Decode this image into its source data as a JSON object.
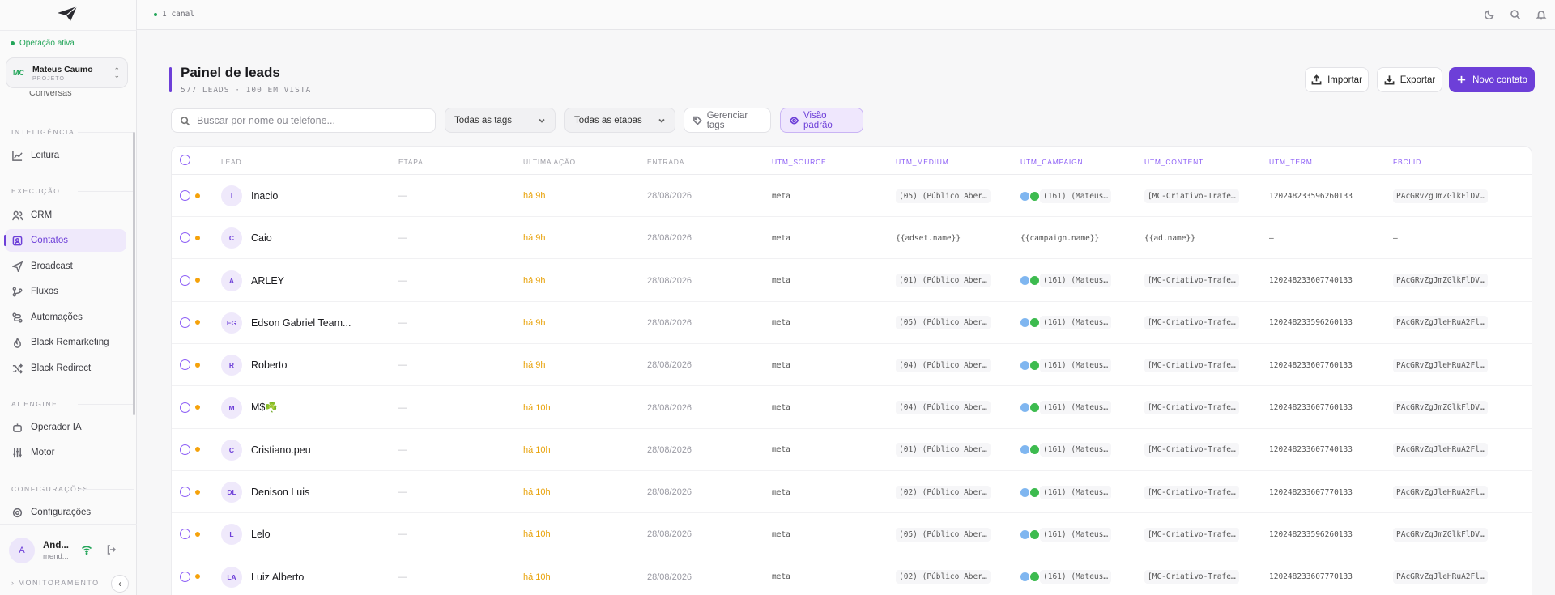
{
  "sidebar": {
    "status": "Operação ativa",
    "project": {
      "initials": "MC",
      "name": "Mateus Caumo",
      "sub": "PROJETO"
    },
    "cut_item": "Conversas",
    "sections": {
      "inteligencia": "INTELIGÊNCIA",
      "execucao": "EXECUÇÃO",
      "ai_engine": "AI ENGINE",
      "config": "CONFIGURAÇÕES"
    },
    "items": {
      "leitura": "Leitura",
      "crm": "CRM",
      "contatos": "Contatos",
      "broadcast": "Broadcast",
      "fluxos": "Fluxos",
      "automacoes": "Automações",
      "black_remarketing": "Black Remarketing",
      "black_redirect": "Black Redirect",
      "operador_ia": "Operador IA",
      "motor": "Motor",
      "configuracoes": "Configurações"
    },
    "user": {
      "initial": "A",
      "name": "And...",
      "email": "mend..."
    },
    "monitor": "MONITORAMENTO"
  },
  "topbar": {
    "channel": "1 canal"
  },
  "page": {
    "title": "Painel de leads",
    "subtitle": "577 LEADS · 100 EM VISTA",
    "import": "Importar",
    "export": "Exportar",
    "new_contact": "Novo contato"
  },
  "filters": {
    "search_placeholder": "Buscar por nome ou telefone...",
    "tags": "Todas as tags",
    "stages": "Todas as etapas",
    "manage_tags": "Gerenciar tags",
    "view": "Visão padrão"
  },
  "table": {
    "headers": {
      "lead": "LEAD",
      "etapa": "ETAPA",
      "ultima": "ÚLTIMA AÇÃO",
      "entrada": "ENTRADA",
      "utm_source": "UTM_SOURCE",
      "utm_medium": "UTM_MEDIUM",
      "utm_campaign": "UTM_CAMPAIGN",
      "utm_content": "UTM_CONTENT",
      "utm_term": "UTM_TERM",
      "fbclid": "FBCLID"
    },
    "rows": [
      {
        "initials": "I",
        "name": "Inacio",
        "etapa": "—",
        "last": "há 9h",
        "date": "28/08/2026",
        "source": "meta",
        "medium": "(05) (Público Aber…",
        "campaign": "(161) (Mateus…",
        "content": "[MC-Criativo-Trafe…",
        "term": "120248233596260133",
        "fbclid": "PAcGRvZgJmZGlkFlDV…"
      },
      {
        "initials": "C",
        "name": "Caio",
        "etapa": "—",
        "last": "há 9h",
        "date": "28/08/2026",
        "source": "meta",
        "medium": "{{adset.name}}",
        "campaign": "{{campaign.name}}",
        "content": "{{ad.name}}",
        "term": "—",
        "fbclid": "—"
      },
      {
        "initials": "A",
        "name": "ARLEY",
        "etapa": "—",
        "last": "há 9h",
        "date": "28/08/2026",
        "source": "meta",
        "medium": "(01) (Público Aber…",
        "campaign": "(161) (Mateus…",
        "content": "[MC-Criativo-Trafe…",
        "term": "120248233607740133",
        "fbclid": "PAcGRvZgJmZGlkFlDV…"
      },
      {
        "initials": "EG",
        "name": "Edson Gabriel Team...",
        "etapa": "—",
        "last": "há 9h",
        "date": "28/08/2026",
        "source": "meta",
        "medium": "(05) (Público Aber…",
        "campaign": "(161) (Mateus…",
        "content": "[MC-Criativo-Trafe…",
        "term": "120248233596260133",
        "fbclid": "PAcGRvZgJleHRuA2Fl…"
      },
      {
        "initials": "R",
        "name": "Roberto",
        "etapa": "—",
        "last": "há 9h",
        "date": "28/08/2026",
        "source": "meta",
        "medium": "(04) (Público Aber…",
        "campaign": "(161) (Mateus…",
        "content": "[MC-Criativo-Trafe…",
        "term": "120248233607760133",
        "fbclid": "PAcGRvZgJleHRuA2Fl…"
      },
      {
        "initials": "M",
        "name": "M$☘️",
        "etapa": "—",
        "last": "há 10h",
        "date": "28/08/2026",
        "source": "meta",
        "medium": "(04) (Público Aber…",
        "campaign": "(161) (Mateus…",
        "content": "[MC-Criativo-Trafe…",
        "term": "120248233607760133",
        "fbclid": "PAcGRvZgJmZGlkFlDV…"
      },
      {
        "initials": "C",
        "name": "Cristiano.peu",
        "etapa": "—",
        "last": "há 10h",
        "date": "28/08/2026",
        "source": "meta",
        "medium": "(01) (Público Aber…",
        "campaign": "(161) (Mateus…",
        "content": "[MC-Criativo-Trafe…",
        "term": "120248233607740133",
        "fbclid": "PAcGRvZgJleHRuA2Fl…"
      },
      {
        "initials": "DL",
        "name": "Denison Luis",
        "etapa": "—",
        "last": "há 10h",
        "date": "28/08/2026",
        "source": "meta",
        "medium": "(02) (Público Aber…",
        "campaign": "(161) (Mateus…",
        "content": "[MC-Criativo-Trafe…",
        "term": "120248233607770133",
        "fbclid": "PAcGRvZgJleHRuA2Fl…"
      },
      {
        "initials": "L",
        "name": "Lelo",
        "etapa": "—",
        "last": "há 10h",
        "date": "28/08/2026",
        "source": "meta",
        "medium": "(05) (Público Aber…",
        "campaign": "(161) (Mateus…",
        "content": "[MC-Criativo-Trafe…",
        "term": "120248233596260133",
        "fbclid": "PAcGRvZgJmZGlkFlDV…"
      },
      {
        "initials": "LA",
        "name": "Luiz Alberto",
        "etapa": "—",
        "last": "há 10h",
        "date": "28/08/2026",
        "source": "meta",
        "medium": "(02) (Público Aber…",
        "campaign": "(161) (Mateus…",
        "content": "[MC-Criativo-Trafe…",
        "term": "120248233607770133",
        "fbclid": "PAcGRvZgJleHRuA2Fl…"
      }
    ]
  },
  "colors": {
    "accent": "#6d3fd8",
    "status_green": "#23a559",
    "action_orange": "#e8a20a"
  }
}
